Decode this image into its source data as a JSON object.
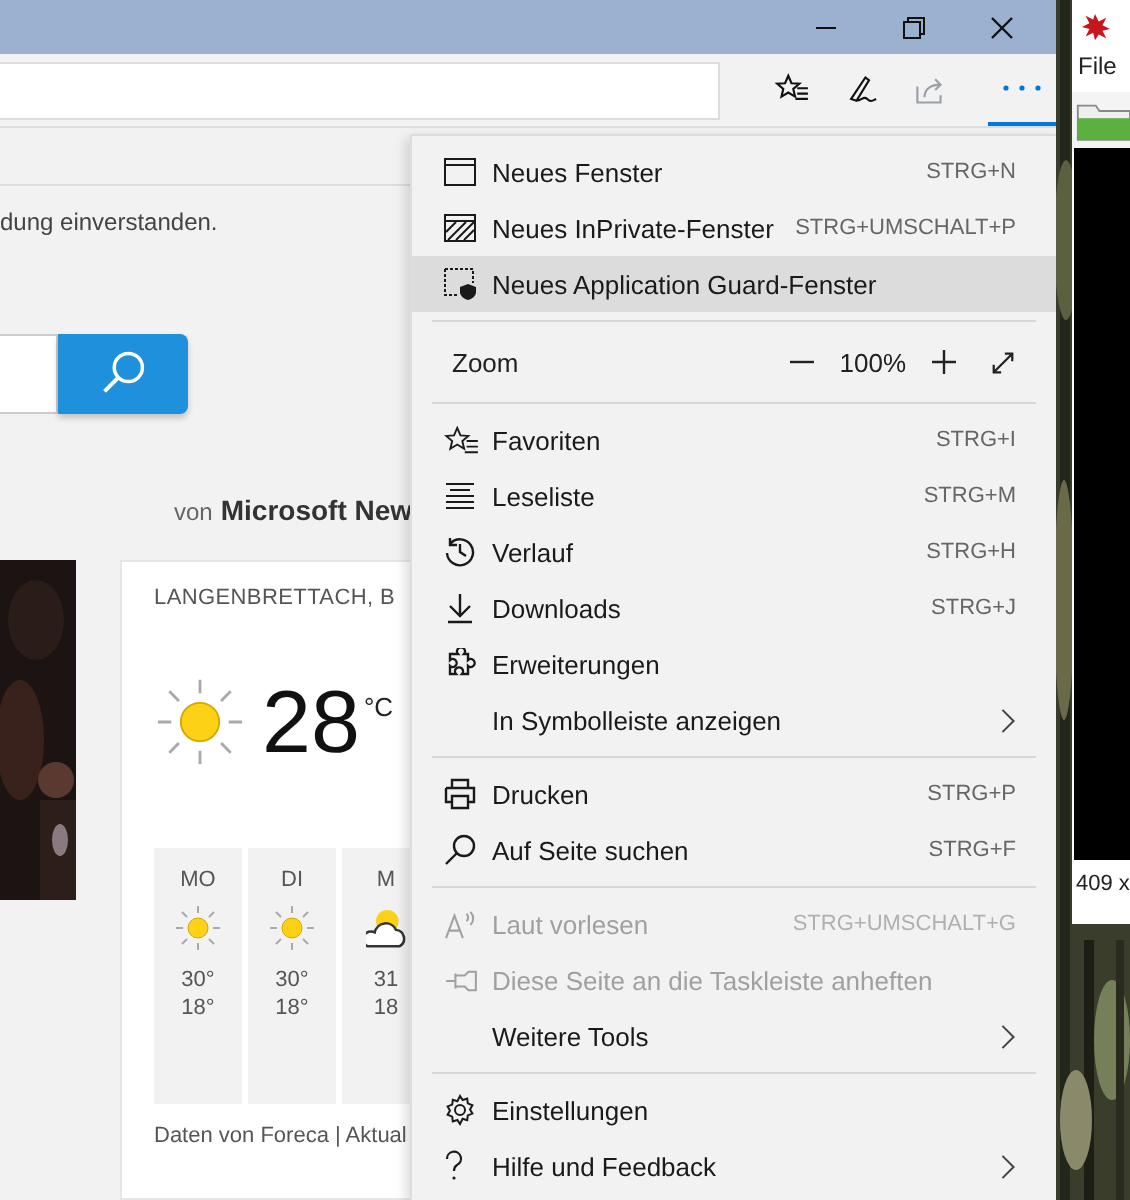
{
  "page": {
    "consent_text": "dung einverstanden.",
    "source_prefix": "von",
    "source_name": "Microsoft New"
  },
  "weather": {
    "location": "LANGENBRETTACH, B",
    "temperature": "28",
    "unit": "°C",
    "days": [
      {
        "kind": "sunny",
        "day": "MO",
        "high": "30°",
        "low": "18°"
      },
      {
        "kind": "sunny",
        "day": "DI",
        "high": "30°",
        "low": "18°"
      },
      {
        "kind": "cloudy",
        "day": "M",
        "high": "31",
        "low": "18"
      }
    ],
    "footer": "Daten von Foreca | Aktual"
  },
  "menu": [
    {
      "kind": "item",
      "label": "Neues Fenster",
      "shortcut": "STRG+N",
      "disabled": false,
      "selected": false,
      "submenu": false
    },
    {
      "kind": "item",
      "label": "Neues InPrivate-Fenster",
      "shortcut": "STRG+UMSCHALT+P",
      "disabled": false,
      "selected": false,
      "submenu": false
    },
    {
      "kind": "item",
      "label": "Neues Application Guard-Fenster",
      "disabled": false,
      "selected": true,
      "submenu": false
    },
    {
      "kind": "separator"
    },
    {
      "kind": "zoom",
      "label": "Zoom",
      "value": "100%"
    },
    {
      "kind": "separator"
    },
    {
      "kind": "item",
      "label": "Favoriten",
      "shortcut": "STRG+I",
      "disabled": false,
      "selected": false,
      "submenu": false
    },
    {
      "kind": "item",
      "label": "Leseliste",
      "shortcut": "STRG+M",
      "disabled": false,
      "selected": false,
      "submenu": false
    },
    {
      "kind": "item",
      "label": "Verlauf",
      "shortcut": "STRG+H",
      "disabled": false,
      "selected": false,
      "submenu": false
    },
    {
      "kind": "item",
      "label": "Downloads",
      "shortcut": "STRG+J",
      "disabled": false,
      "selected": false,
      "submenu": false
    },
    {
      "kind": "item",
      "label": "Erweiterungen",
      "disabled": false,
      "selected": false,
      "submenu": false
    },
    {
      "kind": "item",
      "label": "In Symbolleiste anzeigen",
      "disabled": false,
      "selected": false,
      "submenu": true
    },
    {
      "kind": "separator"
    },
    {
      "kind": "item",
      "label": "Drucken",
      "shortcut": "STRG+P",
      "disabled": false,
      "selected": false,
      "submenu": false
    },
    {
      "kind": "item",
      "label": "Auf Seite suchen",
      "shortcut": "STRG+F",
      "disabled": false,
      "selected": false,
      "submenu": false
    },
    {
      "kind": "separator"
    },
    {
      "kind": "item",
      "label": "Laut vorlesen",
      "shortcut": "STRG+UMSCHALT+G",
      "disabled": true,
      "selected": false,
      "submenu": false
    },
    {
      "kind": "item",
      "label": "Diese Seite an die Taskleiste anheften",
      "disabled": true,
      "selected": false,
      "submenu": false
    },
    {
      "kind": "item",
      "label": "Weitere Tools",
      "disabled": false,
      "selected": false,
      "submenu": true
    },
    {
      "kind": "separator"
    },
    {
      "kind": "item",
      "label": "Einstellungen",
      "disabled": false,
      "selected": false,
      "submenu": false
    },
    {
      "kind": "item",
      "label": "Hilfe und Feedback",
      "disabled": false,
      "selected": false,
      "submenu": true
    }
  ],
  "other_window": {
    "menu_item": "File",
    "status": "409 x"
  }
}
